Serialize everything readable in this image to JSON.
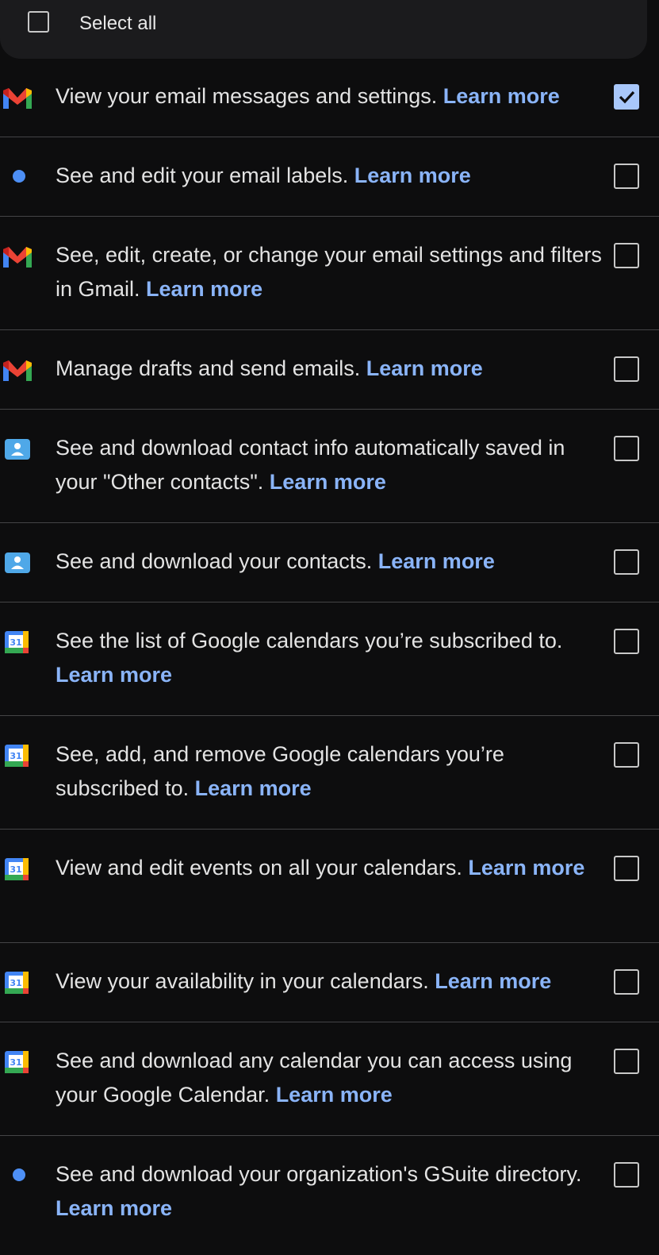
{
  "select_all": {
    "label": "Select all",
    "checked": false
  },
  "learn_more_label": "Learn more",
  "colors": {
    "background": "#0d0d0e",
    "link": "#8ab4f8",
    "divider": "#444446",
    "checked_fill": "#a8c7fa"
  },
  "permissions": [
    {
      "icon": "gmail-icon",
      "text": "View your email messages and settings.",
      "checked": true
    },
    {
      "icon": "blue-dot-icon",
      "text": "See and edit your email labels.",
      "checked": false
    },
    {
      "icon": "gmail-icon",
      "text": "See, edit, create, or change your email settings and filters in Gmail.",
      "checked": false
    },
    {
      "icon": "gmail-icon",
      "text": "Manage drafts and send emails.",
      "checked": false
    },
    {
      "icon": "contacts-icon",
      "text": "See and download contact info automatically saved in your \"Other contacts\".",
      "checked": false
    },
    {
      "icon": "contacts-icon",
      "text": "See and download your contacts.",
      "checked": false
    },
    {
      "icon": "calendar-icon",
      "text": "See the list of Google calendars you’re subscribed to.",
      "checked": false
    },
    {
      "icon": "calendar-icon",
      "text": "See, add, and remove Google calendars you’re subscribed to.",
      "checked": false
    },
    {
      "icon": "calendar-icon",
      "text": "View and edit events on all your calendars.",
      "checked": false
    },
    {
      "icon": "calendar-icon",
      "text": "View your availability in your calendars.",
      "checked": false
    },
    {
      "icon": "calendar-icon",
      "text": "See and download any calendar you can access using your Google Calendar.",
      "checked": false
    },
    {
      "icon": "blue-dot-icon",
      "text": "See and download your organization's GSuite directory.",
      "checked": false
    }
  ]
}
